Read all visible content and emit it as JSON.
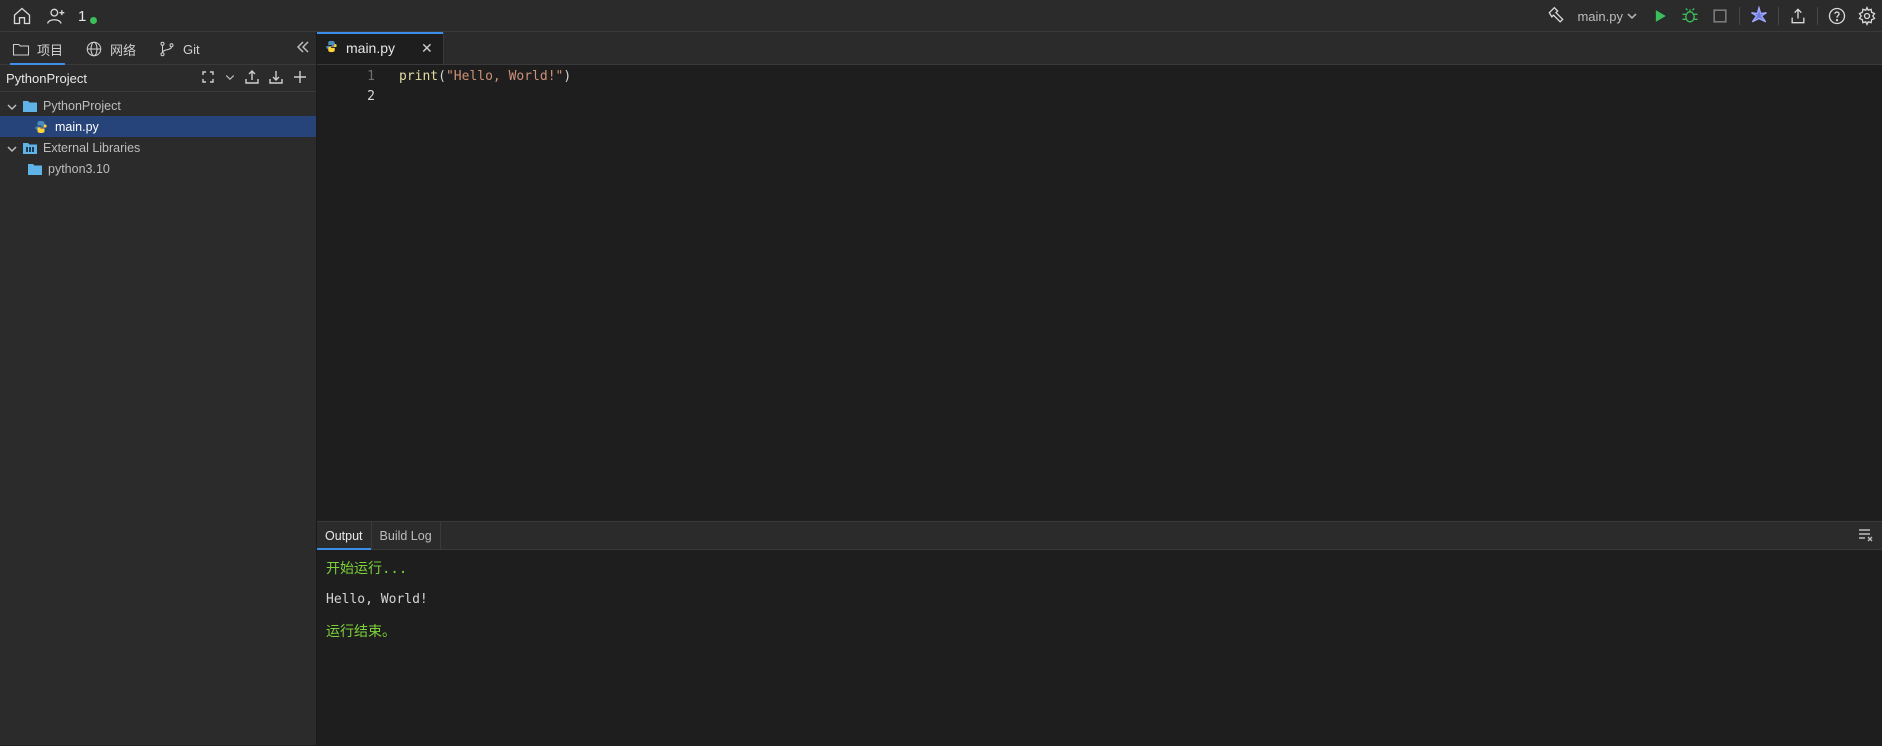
{
  "topbar": {
    "counter": "1",
    "run_config": "main.py",
    "colors": {
      "run": "#3bbf5a",
      "debug": "#3bbf5a",
      "accent": "#3d8ee8"
    }
  },
  "sidebar": {
    "tabs": [
      {
        "label": "项目",
        "icon": "folder-icon",
        "active": true
      },
      {
        "label": "网络",
        "icon": "globe-icon",
        "active": false
      },
      {
        "label": "Git",
        "icon": "git-branch-icon",
        "active": false
      }
    ],
    "project_title": "PythonProject",
    "tree": [
      {
        "label": "PythonProject",
        "type": "folder",
        "expanded": true,
        "depth": 0
      },
      {
        "label": "main.py",
        "type": "python-file",
        "selected": true,
        "depth": 1
      },
      {
        "label": "External Libraries",
        "type": "library-folder",
        "expanded": true,
        "depth": 0
      },
      {
        "label": "python3.10",
        "type": "folder",
        "depth": 1
      }
    ]
  },
  "editor": {
    "tab": {
      "label": "main.py",
      "close": "✕"
    },
    "lines": [
      {
        "number": "1",
        "func": "print",
        "open": "(",
        "string": "\"Hello, World!\"",
        "close": ")"
      },
      {
        "number": "2",
        "func": "",
        "open": "",
        "string": "",
        "close": ""
      }
    ]
  },
  "bottom_panel": {
    "tabs": [
      {
        "label": "Output",
        "active": true
      },
      {
        "label": "Build Log",
        "active": false
      }
    ],
    "output": [
      {
        "text": "开始运行...",
        "style": "green"
      },
      {
        "text": "Hello, World!",
        "style": "plain"
      },
      {
        "text": "运行结束。",
        "style": "green"
      }
    ]
  }
}
